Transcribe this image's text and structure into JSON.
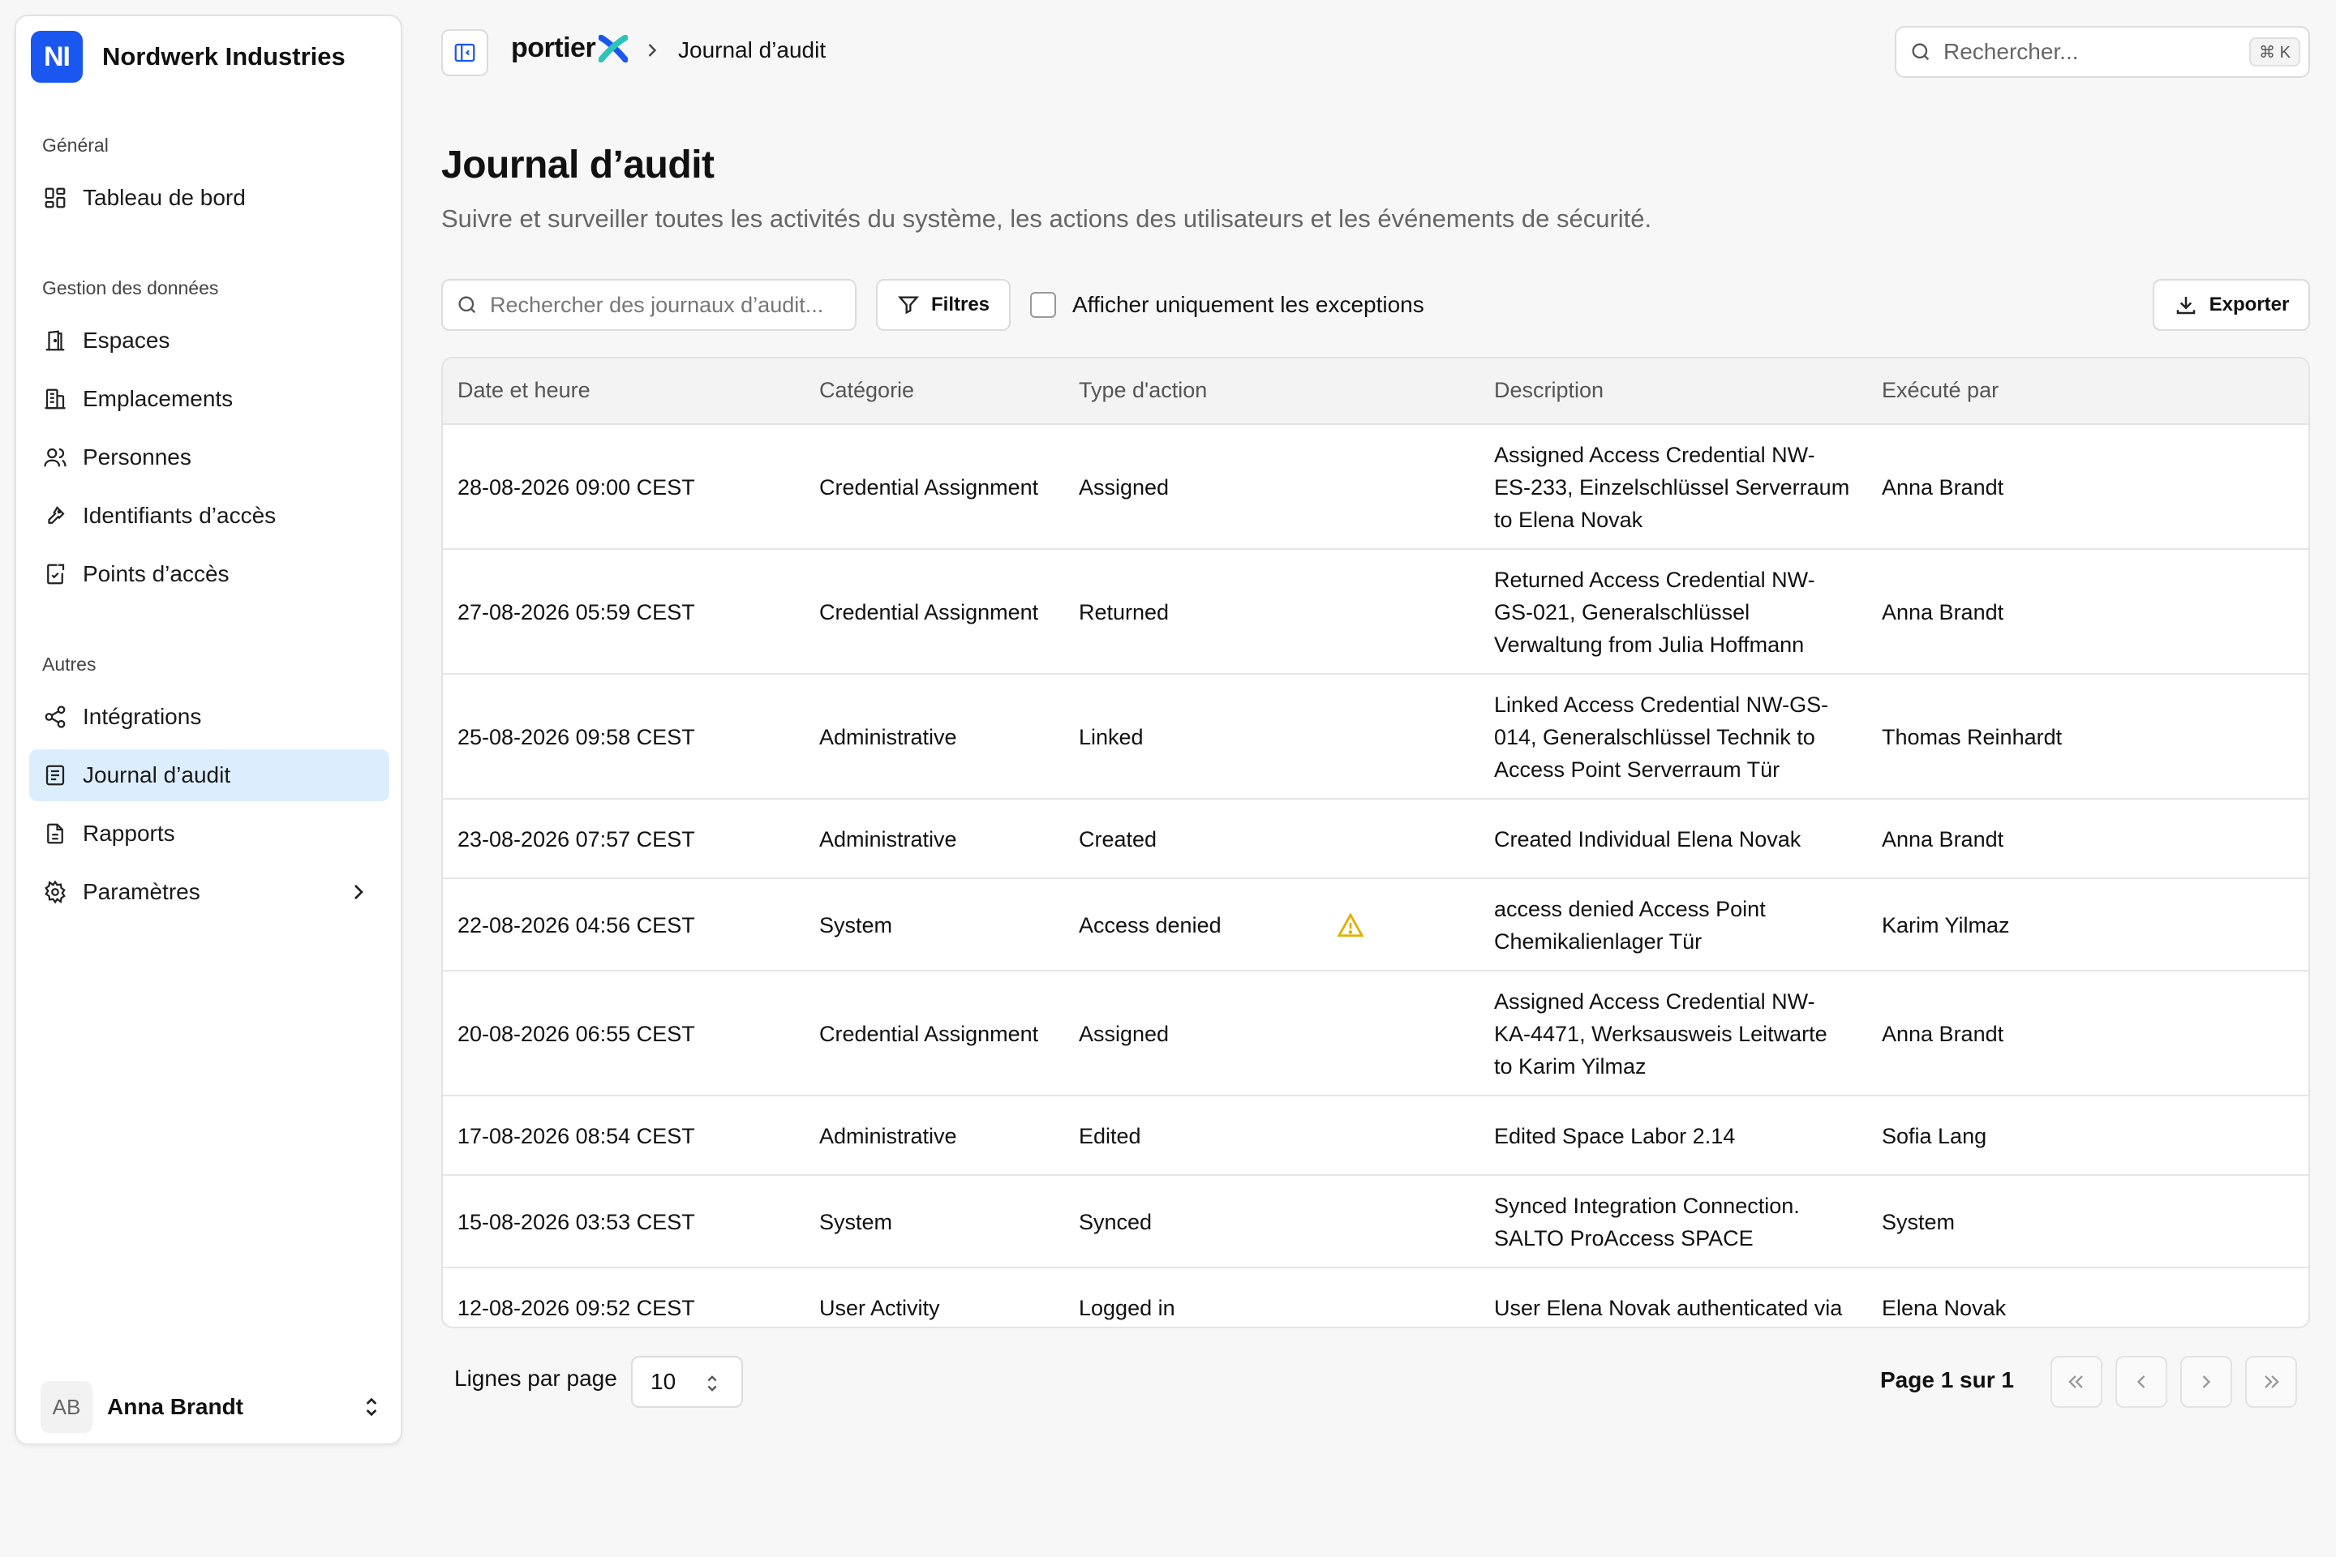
{
  "org": {
    "initials": "NI",
    "name": "Nordwerk Industries",
    "brand_color": "#1a56f0"
  },
  "sidebar": {
    "groups": [
      {
        "label": "Général",
        "items": [
          {
            "label": "Tableau de bord",
            "icon": "dashboard-icon"
          }
        ]
      },
      {
        "label": "Gestion des données",
        "items": [
          {
            "label": "Espaces",
            "icon": "door-icon"
          },
          {
            "label": "Emplacements",
            "icon": "building-icon"
          },
          {
            "label": "Personnes",
            "icon": "users-icon"
          },
          {
            "label": "Identifiants d’accès",
            "icon": "key-icon"
          },
          {
            "label": "Points d’accès",
            "icon": "access-point-icon"
          }
        ]
      },
      {
        "label": "Autres",
        "items": [
          {
            "label": "Intégrations",
            "icon": "share-icon"
          },
          {
            "label": "Journal d’audit",
            "icon": "audit-log-icon",
            "active": true
          },
          {
            "label": "Rapports",
            "icon": "report-icon"
          },
          {
            "label": "Paramètres",
            "icon": "gear-icon"
          }
        ]
      }
    ],
    "active_color": "#dceefe"
  },
  "user": {
    "initials": "AB",
    "name": "Anna Brandt"
  },
  "topbar": {
    "product": "portier",
    "breadcrumb_current": "Journal d’audit",
    "search_placeholder": "Rechercher...",
    "shortcut": "⌘ K"
  },
  "page": {
    "title": "Journal d’audit",
    "subtitle": "Suivre et surveiller toutes les activités du système, les actions des utilisateurs et les événements de sécurité."
  },
  "toolbar": {
    "search_placeholder": "Rechercher des journaux d’audit...",
    "filters_label": "Filtres",
    "exceptions_label": "Afficher uniquement les exceptions",
    "export_label": "Exporter"
  },
  "table": {
    "columns": [
      "Date et heure",
      "Catégorie",
      "Type d'action",
      "Description",
      "Exécuté par"
    ],
    "rows": [
      {
        "datetime": "28-08-2026 09:00 CEST",
        "category": "Credential Assignment",
        "action": "Assigned",
        "warning": false,
        "description": [
          "Assigned Access Credential NW-",
          "ES-233, Einzelschlüssel Serverraum",
          "to Elena Novak"
        ],
        "by": "Anna Brandt"
      },
      {
        "datetime": "27-08-2026 05:59 CEST",
        "category": "Credential Assignment",
        "action": "Returned",
        "warning": false,
        "description": [
          "Returned Access Credential NW-",
          "GS-021, Generalschlüssel",
          "Verwaltung from Julia Hoffmann"
        ],
        "by": "Anna Brandt"
      },
      {
        "datetime": "25-08-2026 09:58 CEST",
        "category": "Administrative",
        "action": "Linked",
        "warning": false,
        "description": [
          "Linked Access Credential NW-GS-",
          "014, Generalschlüssel Technik to",
          "Access Point Serverraum Tür"
        ],
        "by": "Thomas Reinhardt"
      },
      {
        "datetime": "23-08-2026 07:57 CEST",
        "category": "Administrative",
        "action": "Created",
        "warning": false,
        "description": [
          "Created Individual Elena Novak"
        ],
        "by": "Anna Brandt"
      },
      {
        "datetime": "22-08-2026 04:56 CEST",
        "category": "System",
        "action": "Access denied",
        "warning": true,
        "description": [
          "access denied Access Point",
          "Chemikalienlager Tür"
        ],
        "by": "Karim Yilmaz"
      },
      {
        "datetime": "20-08-2026 06:55 CEST",
        "category": "Credential Assignment",
        "action": "Assigned",
        "warning": false,
        "description": [
          "Assigned Access Credential NW-",
          "KA-4471, Werksausweis Leitwarte",
          "to Karim Yilmaz"
        ],
        "by": "Anna Brandt"
      },
      {
        "datetime": "17-08-2026 08:54 CEST",
        "category": "Administrative",
        "action": "Edited",
        "warning": false,
        "description": [
          "Edited Space Labor 2.14"
        ],
        "by": "Sofia Lang"
      },
      {
        "datetime": "15-08-2026 03:53 CEST",
        "category": "System",
        "action": "Synced",
        "warning": false,
        "description": [
          "Synced Integration Connection.",
          "SALTO ProAccess SPACE"
        ],
        "by": "System"
      },
      {
        "datetime": "12-08-2026 09:52 CEST",
        "category": "User Activity",
        "action": "Logged in",
        "warning": false,
        "description": [
          "User Elena Novak authenticated via"
        ],
        "by": "Elena Novak"
      }
    ],
    "warning_color": "#e0b000"
  },
  "pagination": {
    "rows_per_page_label": "Lignes par page",
    "rows_per_page_value": "10",
    "page_info": "Page 1 sur 1"
  }
}
